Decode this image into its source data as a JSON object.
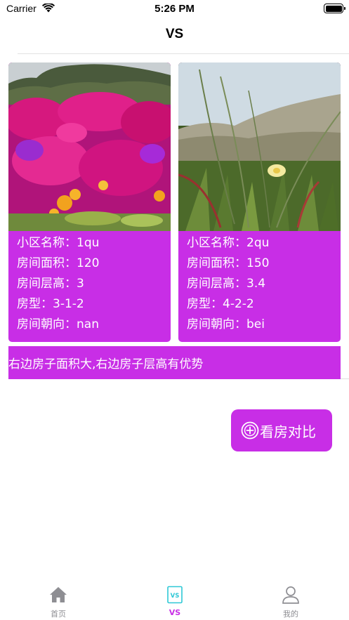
{
  "status_bar": {
    "carrier": "Carrier",
    "time": "5:26 PM"
  },
  "nav": {
    "title": "VS"
  },
  "houses": [
    {
      "name_label": "小区名称：",
      "name": "1qu",
      "area_label": "房间面积：",
      "area": "120",
      "height_label": "房间层高：",
      "height": "3",
      "type_label": "房型：",
      "type": "3-1-2",
      "orientation_label": "房间朝向：",
      "orientation": "nan"
    },
    {
      "name_label": "小区名称：",
      "name": "2qu",
      "area_label": "房间面积：",
      "area": "150",
      "height_label": "房间层高：",
      "height": "3.4",
      "type_label": "房型：",
      "type": "4-2-2",
      "orientation_label": "房间朝向：",
      "orientation": "bei"
    }
  ],
  "conclusion": "右边房子面积大,右边房子层高有优势",
  "compare_button": {
    "label": "看房对比",
    "icon": "plus-circle-icon"
  },
  "tabs": [
    {
      "label": "首页",
      "icon": "home-icon",
      "active": false
    },
    {
      "label": "VS",
      "icon": "vs-icon",
      "active": true
    },
    {
      "label": "我的",
      "icon": "person-icon",
      "active": false
    }
  ],
  "colors": {
    "accent": "#c82ee6",
    "tab_inactive": "#8e8e93",
    "text_light": "#ffffff"
  }
}
